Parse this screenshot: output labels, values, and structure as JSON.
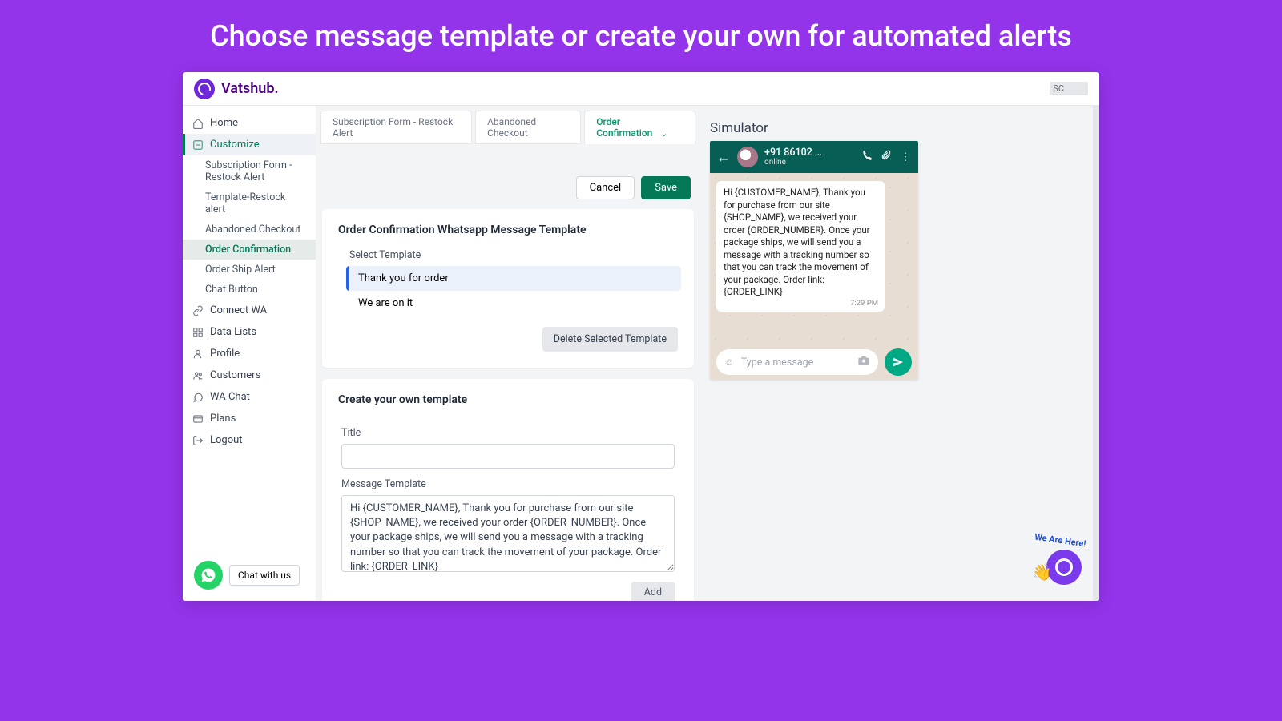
{
  "hero": "Choose message template or create your own for automated alerts",
  "brand": "Vatshub.",
  "user_badge": "SC",
  "sidebar": {
    "home": "Home",
    "customize": "Customize",
    "subs": [
      "Subscription Form - Restock Alert",
      "Template-Restock alert",
      "Abandoned Checkout",
      "Order Confirmation",
      "Order Ship Alert",
      "Chat Button"
    ],
    "connect": "Connect WA",
    "datalists": "Data Lists",
    "profile": "Profile",
    "customers": "Customers",
    "wachat": "WA Chat",
    "plans": "Plans",
    "logout": "Logout"
  },
  "tabs": [
    "Subscription Form - Restock Alert",
    "Abandoned Checkout",
    "Order Confirmation"
  ],
  "actions": {
    "cancel": "Cancel",
    "save": "Save"
  },
  "card1": {
    "title": "Order Confirmation Whatsapp Message Template",
    "select_label": "Select Template",
    "templates": [
      "Thank you for order",
      "We are on it"
    ],
    "delete": "Delete Selected Template"
  },
  "card2": {
    "title": "Create your own template",
    "title_label": "Title",
    "msg_label": "Message Template",
    "msg_value": "Hi {CUSTOMER_NAME}, Thank you for purchase from our site {SHOP_NAME}, we received your order {ORDER_NUMBER}. Once your package ships, we will send you a message with a tracking number so that you can track the movement of your package. Order link: {ORDER_LINK}",
    "add": "Add"
  },
  "sim": {
    "title": "Simulator",
    "number": "+91 86102 …",
    "status": "online",
    "bubble": "Hi {CUSTOMER_NAME}, Thank you for purchase from our site {SHOP_NAME}, we received your order {ORDER_NUMBER}. Once your package ships, we will send you a message with a tracking number so that you can track the movement of your package. Order link: {ORDER_LINK}",
    "time": "7:29 PM",
    "placeholder": "Type a message"
  },
  "chat_pill": "Chat with us",
  "we_are_here": "We Are Here!"
}
